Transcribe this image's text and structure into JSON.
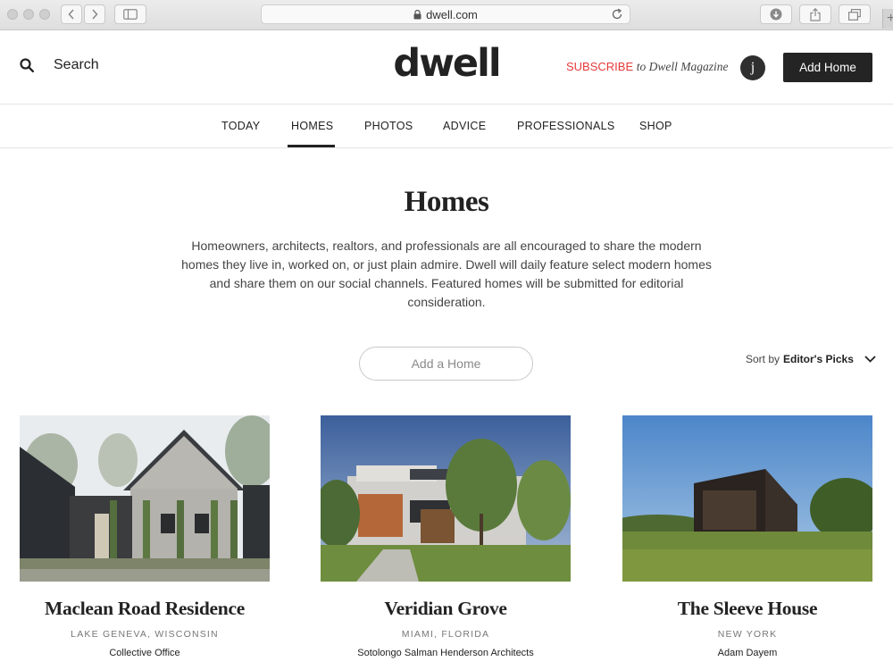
{
  "browser": {
    "url": "dwell.com"
  },
  "header": {
    "search_label": "Search",
    "logo": "dwell",
    "subscribe_word": "SUBSCRIBE",
    "subscribe_tail": "to Dwell Magazine",
    "avatar_initial": "j",
    "add_home_label": "Add Home"
  },
  "nav": {
    "items": [
      "TODAY",
      "HOMES",
      "PHOTOS",
      "ADVICE",
      "PROFESSIONALS",
      "SHOP"
    ],
    "active": "HOMES"
  },
  "hero": {
    "title": "Homes",
    "intro": "Homeowners, architects, realtors, and professionals are all encouraged to share the modern homes they live in, worked on, or just plain admire. Dwell will daily feature select modern homes and share them on our social channels. Featured homes will be submitted for editorial consideration.",
    "add_home_pill": "Add a Home",
    "sort_prefix": "Sort by",
    "sort_value": "Editor's Picks"
  },
  "cards": [
    {
      "title": "Maclean Road Residence",
      "location": "LAKE GENEVA, WISCONSIN",
      "architect": "Collective Office"
    },
    {
      "title": "Veridian Grove",
      "location": "MIAMI, FLORIDA",
      "architect": "Sotolongo Salman Henderson Architects"
    },
    {
      "title": "The Sleeve House",
      "location": "NEW YORK",
      "architect": "Adam Dayem"
    }
  ],
  "colors": {
    "accent_red": "#e63a3a",
    "dark_button": "#242424"
  }
}
